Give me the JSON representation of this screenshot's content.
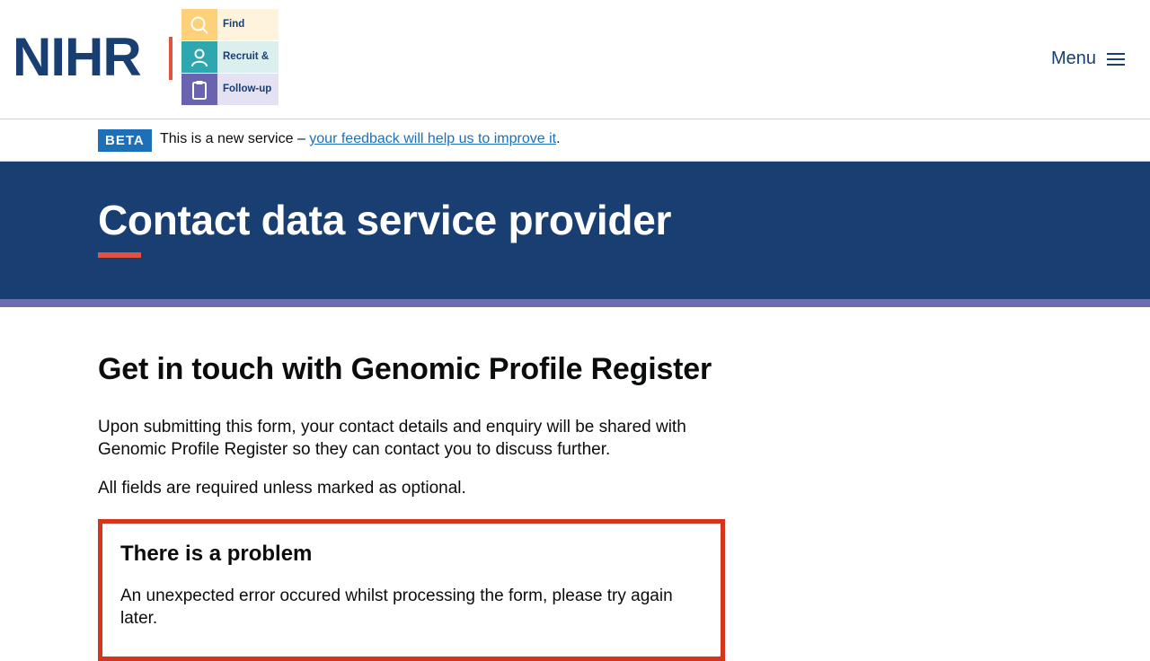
{
  "header": {
    "logo_text": "NIHR",
    "tiles": [
      {
        "label": "Find",
        "icon": "search-icon",
        "color": "#fdd17a",
        "bg": "#fef3dc"
      },
      {
        "label": "Recruit &",
        "icon": "person-icon",
        "color": "#2fa7ae",
        "bg": "#dcefef"
      },
      {
        "label": "Follow-up",
        "icon": "clipboard-icon",
        "color": "#6a64b0",
        "bg": "#e3e1f2"
      }
    ],
    "menu_label": "Menu"
  },
  "beta": {
    "tag": "BETA",
    "text": "This is a new service – ",
    "link": "your feedback will help us to improve it",
    "suffix": "."
  },
  "hero": {
    "title": "Contact data service provider"
  },
  "main": {
    "heading": "Get in touch with Genomic Profile Register",
    "intro": "Upon submitting this form, your contact details and enquiry will be shared with Genomic Profile Register so they can contact you to discuss further.",
    "required_note": "All fields are required unless marked as optional."
  },
  "error": {
    "title": "There is a problem",
    "message": "An unexpected error occured whilst processing the form, please try again later."
  },
  "colors": {
    "brand_navy": "#193e72",
    "accent_red": "#e1523f",
    "link_blue": "#1d70b8",
    "error_red": "#d4351c",
    "purple": "#6c6cb0"
  }
}
